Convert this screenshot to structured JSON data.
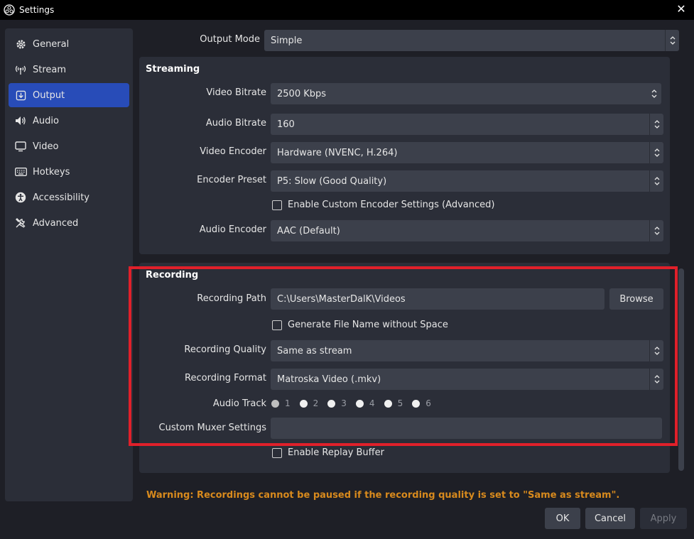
{
  "window": {
    "title": "Settings",
    "close_glyph": "✕"
  },
  "sidebar": {
    "items": [
      {
        "label": "General",
        "icon": "gear-icon"
      },
      {
        "label": "Stream",
        "icon": "antenna-icon"
      },
      {
        "label": "Output",
        "icon": "output-icon"
      },
      {
        "label": "Audio",
        "icon": "speaker-icon"
      },
      {
        "label": "Video",
        "icon": "monitor-icon"
      },
      {
        "label": "Hotkeys",
        "icon": "keyboard-icon"
      },
      {
        "label": "Accessibility",
        "icon": "accessibility-icon"
      },
      {
        "label": "Advanced",
        "icon": "tools-icon"
      }
    ],
    "selected": "Output",
    "accent": "#284cb8"
  },
  "output_mode": {
    "label": "Output Mode",
    "value": "Simple"
  },
  "streaming": {
    "title": "Streaming",
    "video_bitrate": {
      "label": "Video Bitrate",
      "value": "2500 Kbps"
    },
    "audio_bitrate": {
      "label": "Audio Bitrate",
      "value": "160"
    },
    "video_encoder": {
      "label": "Video Encoder",
      "value": "Hardware (NVENC, H.264)"
    },
    "encoder_preset": {
      "label": "Encoder Preset",
      "value": "P5: Slow (Good Quality)"
    },
    "custom_encoder": {
      "label": "Enable Custom Encoder Settings (Advanced)",
      "checked": false
    },
    "audio_encoder": {
      "label": "Audio Encoder",
      "value": "AAC (Default)"
    }
  },
  "recording": {
    "title": "Recording",
    "path": {
      "label": "Recording Path",
      "value": "C:\\Users\\MasterDalK\\Videos",
      "browse_label": "Browse"
    },
    "no_space": {
      "label": "Generate File Name without Space",
      "checked": false
    },
    "quality": {
      "label": "Recording Quality",
      "value": "Same as stream"
    },
    "format": {
      "label": "Recording Format",
      "value": "Matroska Video (.mkv)"
    },
    "audio_track": {
      "label": "Audio Track",
      "tracks": [
        "1",
        "2",
        "3",
        "4",
        "5",
        "6"
      ],
      "selected": "1"
    },
    "muxer": {
      "label": "Custom Muxer Settings",
      "value": ""
    }
  },
  "replay_buffer": {
    "label": "Enable Replay Buffer",
    "checked": false
  },
  "warning": "Warning: Recordings cannot be paused if the recording quality is set to \"Same as stream\".",
  "buttons": {
    "ok": "OK",
    "cancel": "Cancel",
    "apply": "Apply"
  },
  "colors": {
    "highlight": "#e0202a",
    "warning": "#d88a1d"
  }
}
